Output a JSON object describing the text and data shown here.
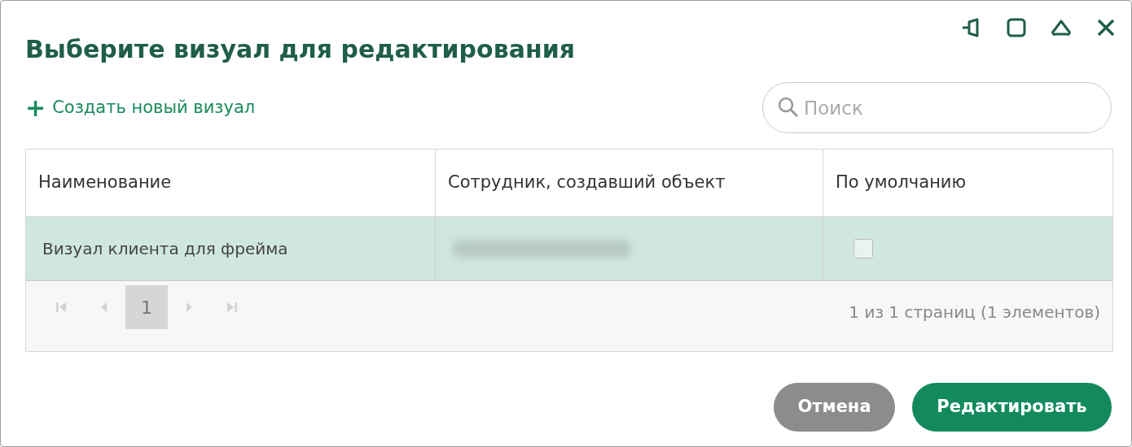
{
  "dialog": {
    "title": "Выберите визуал для редактирования"
  },
  "window_controls": [
    {
      "kind": "pin"
    },
    {
      "kind": "maximize"
    },
    {
      "kind": "collapse"
    },
    {
      "kind": "close"
    }
  ],
  "create_link": {
    "icon": "+",
    "label": "Создать новый визуал"
  },
  "search": {
    "placeholder": "Поиск"
  },
  "table": {
    "columns": [
      "Наименование",
      "Сотрудник, создавший объект",
      "По умолчанию"
    ],
    "rows": [
      {
        "name": "Визуал клиента для фрейма",
        "selected": true,
        "default_checked": false
      }
    ]
  },
  "pager": {
    "nav": [
      {
        "kind": "first",
        "disabled": true
      },
      {
        "kind": "prev",
        "disabled": true
      },
      {
        "kind": "page",
        "label": "1",
        "selected": true
      },
      {
        "kind": "next",
        "disabled": true
      },
      {
        "kind": "last",
        "disabled": true
      }
    ],
    "info": "1 из 1 страниц (1 элементов)"
  },
  "buttons": [
    {
      "kind": "secondary",
      "label": "Отмена"
    },
    {
      "kind": "primary",
      "label": "Редактировать"
    }
  ]
}
